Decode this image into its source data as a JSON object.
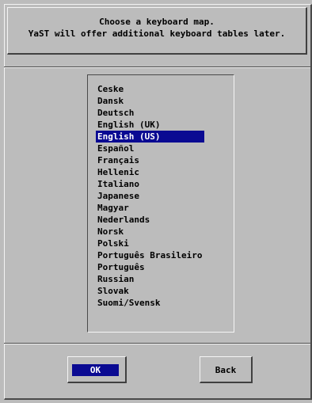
{
  "header": {
    "line1": "Choose a keyboard map.",
    "line2": "YaST will offer additional keyboard tables later."
  },
  "keyboard_list": {
    "selected": "English (US)",
    "items": [
      "Ceske",
      "Dansk",
      "Deutsch",
      "English (UK)",
      "English (US)",
      "Español",
      "Français",
      "Hellenic",
      "Italiano",
      "Japanese",
      "Magyar",
      "Nederlands",
      "Norsk",
      "Polski",
      "Português Brasileiro",
      "Português",
      "Russian",
      "Slovak",
      "Suomi/Svensk"
    ]
  },
  "buttons": {
    "ok_label": "OK",
    "back_label": "Back"
  },
  "colors": {
    "background": "#bcbcbc",
    "selection": "#0a0a92",
    "selection_text": "#ffffff"
  }
}
